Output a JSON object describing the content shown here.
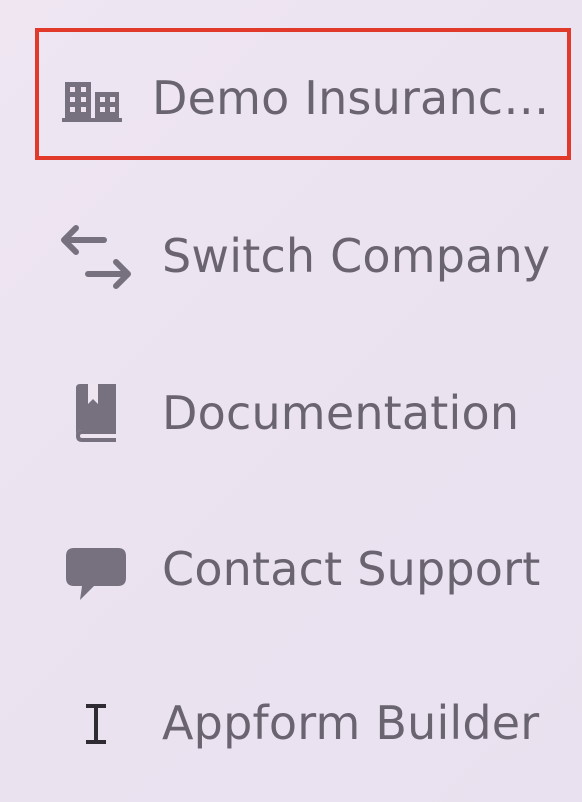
{
  "menu": {
    "items": [
      {
        "label": "Demo Insuranc…",
        "icon": "building-icon",
        "highlighted": true
      },
      {
        "label": "Switch Company",
        "icon": "switch-arrows-icon"
      },
      {
        "label": "Documentation",
        "icon": "book-icon"
      },
      {
        "label": "Contact Support",
        "icon": "chat-bubble-icon"
      },
      {
        "label": "Appform Builder",
        "icon": "text-cursor-icon"
      }
    ]
  },
  "colors": {
    "background": "#eee5f1",
    "text": "#6a6471",
    "icon": "#77717f",
    "highlight_border": "#e13a2b"
  }
}
